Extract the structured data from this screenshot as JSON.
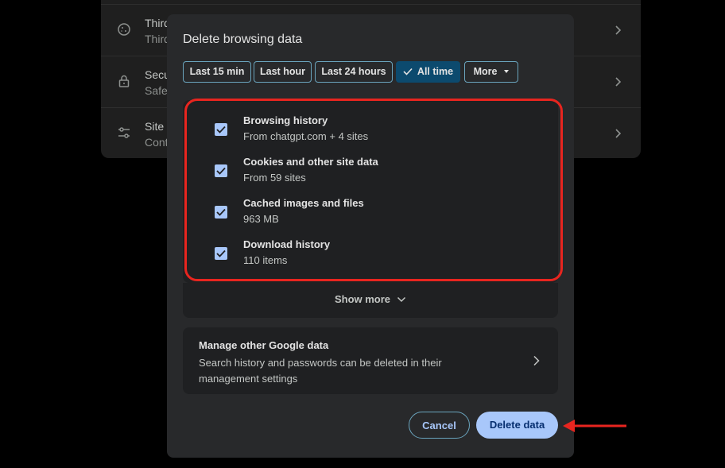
{
  "background": {
    "rows": [
      {
        "title": "Third",
        "subtitle": "Third",
        "icon": "cookie-icon"
      },
      {
        "title": "Secu",
        "subtitle": "Safe",
        "icon": "lock-icon"
      },
      {
        "title": "Site",
        "subtitle": "Cont",
        "icon": "sliders-icon"
      }
    ]
  },
  "dialog": {
    "title": "Delete browsing data",
    "time_ranges": [
      {
        "label": "Last 15 min",
        "selected": false
      },
      {
        "label": "Last hour",
        "selected": false
      },
      {
        "label": "Last 24 hours",
        "selected": false
      },
      {
        "label": "All time",
        "selected": true
      },
      {
        "label": "More",
        "selected": false
      }
    ],
    "items": [
      {
        "title": "Browsing history",
        "subtitle": "From chatgpt.com + 4 sites",
        "checked": true
      },
      {
        "title": "Cookies and other site data",
        "subtitle": "From 59 sites",
        "checked": true
      },
      {
        "title": "Cached images and files",
        "subtitle": "963 MB",
        "checked": true
      },
      {
        "title": "Download history",
        "subtitle": "110 items",
        "checked": true
      }
    ],
    "show_more": "Show more",
    "manage": {
      "title": "Manage other Google data",
      "description": "Search history and passwords can be deleted in their management settings"
    },
    "cancel_label": "Cancel",
    "delete_label": "Delete data"
  },
  "colors": {
    "accent": "#a8c7fa",
    "selected_chip": "#0c4a6e",
    "highlight_outline": "#e8251f",
    "dialog_bg": "#28292b"
  }
}
